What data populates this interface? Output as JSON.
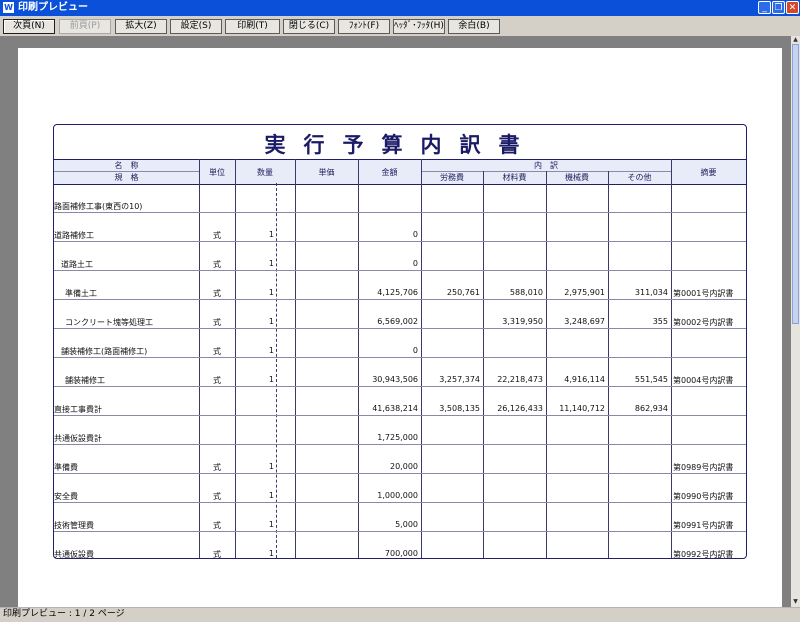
{
  "window": {
    "title": "印刷プレビュー"
  },
  "toolbar": {
    "buttons": [
      "次頁(N)",
      "前頁(P)",
      "拡大(Z)",
      "設定(S)",
      "印刷(T)",
      "閉じる(C)",
      "ﾌｫﾝﾄ(F)",
      "ﾍｯﾀﾞ･ﾌｯﾀ(H)",
      "余白(B)"
    ]
  },
  "document": {
    "title": "実行予算内訳書",
    "headers": {
      "name": "名　称",
      "spec": "規　格",
      "unit": "単位",
      "qty": "数量",
      "price": "単価",
      "amount": "金額",
      "breakdown": "内　訳",
      "labor": "労務費",
      "material": "材料費",
      "machine": "機械費",
      "other": "その他",
      "remarks": "摘要"
    },
    "rows": [
      {
        "name": "路面補修工事(東西の10)",
        "unit": "",
        "qty": "",
        "amount": "",
        "labor": "",
        "material": "",
        "machine": "",
        "other": "",
        "remarks": ""
      },
      {
        "name": "道路補修工",
        "unit": "式",
        "qty": "1",
        "amount": "0",
        "labor": "",
        "material": "",
        "machine": "",
        "other": "",
        "remarks": ""
      },
      {
        "name": "道路土工",
        "unit": "式",
        "qty": "1",
        "amount": "0",
        "labor": "",
        "material": "",
        "machine": "",
        "other": "",
        "remarks": ""
      },
      {
        "name": "準備土工",
        "unit": "式",
        "qty": "1",
        "amount": "4,125,706",
        "labor": "250,761",
        "material": "588,010",
        "machine": "2,975,901",
        "other": "311,034",
        "remarks": "第0001号内訳書"
      },
      {
        "name": "コンクリート塊等処理工",
        "unit": "式",
        "qty": "1",
        "amount": "6,569,002",
        "labor": "",
        "material": "3,319,950",
        "machine": "3,248,697",
        "other": "355",
        "remarks": "第0002号内訳書"
      },
      {
        "name": "舗装補修工(路面補修工)",
        "unit": "式",
        "qty": "1",
        "amount": "0",
        "labor": "",
        "material": "",
        "machine": "",
        "other": "",
        "remarks": ""
      },
      {
        "name": "舗装補修工",
        "unit": "式",
        "qty": "1",
        "amount": "30,943,506",
        "labor": "3,257,374",
        "material": "22,218,473",
        "machine": "4,916,114",
        "other": "551,545",
        "remarks": "第0004号内訳書"
      },
      {
        "name": "直接工事費計",
        "unit": "",
        "qty": "",
        "amount": "41,638,214",
        "labor": "3,508,135",
        "material": "26,126,433",
        "machine": "11,140,712",
        "other": "862,934",
        "remarks": ""
      },
      {
        "name": "共通仮設費計",
        "unit": "",
        "qty": "",
        "amount": "1,725,000",
        "labor": "",
        "material": "",
        "machine": "",
        "other": "",
        "remarks": ""
      },
      {
        "name": "準備費",
        "unit": "式",
        "qty": "1",
        "amount": "20,000",
        "labor": "",
        "material": "",
        "machine": "",
        "other": "",
        "remarks": "第0989号内訳書"
      },
      {
        "name": "安全費",
        "unit": "式",
        "qty": "1",
        "amount": "1,000,000",
        "labor": "",
        "material": "",
        "machine": "",
        "other": "",
        "remarks": "第0990号内訳書"
      },
      {
        "name": "技術管理費",
        "unit": "式",
        "qty": "1",
        "amount": "5,000",
        "labor": "",
        "material": "",
        "machine": "",
        "other": "",
        "remarks": "第0991号内訳書"
      },
      {
        "name": "共通仮設費",
        "unit": "式",
        "qty": "1",
        "amount": "700,000",
        "labor": "",
        "material": "",
        "machine": "",
        "other": "",
        "remarks": "第0992号内訳書"
      }
    ]
  },
  "status": {
    "text": "印刷プレビュー : 1 / 2 ページ"
  }
}
